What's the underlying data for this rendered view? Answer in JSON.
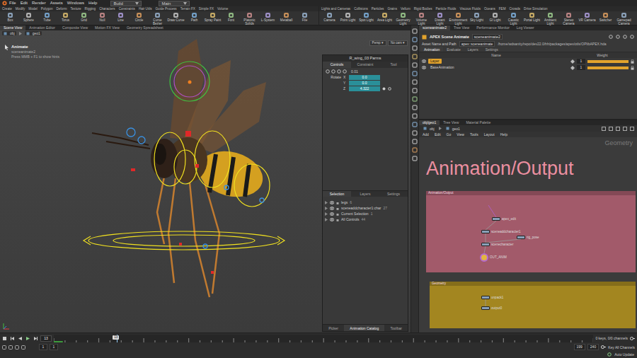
{
  "menubar": {
    "items": [
      "File",
      "Edit",
      "Render",
      "Assets",
      "Windows",
      "Help"
    ],
    "desktop": "Build",
    "shelf_set": "Main"
  },
  "shelf_left": {
    "tabs": [
      "Create",
      "Modify",
      "Model",
      "Polygon",
      "Deform",
      "Texture",
      "Rigging",
      "Characters",
      "Constraints",
      "Hair Utils",
      "Guide Process",
      "Terrain FX",
      "Simple FX",
      "Volume"
    ],
    "tools": [
      "Box",
      "Sphere",
      "Tube",
      "Torus",
      "Grid",
      "Null",
      "Line",
      "Circle",
      "Curve Bezier",
      "Draw Curve",
      "Path",
      "Spray Paint",
      "Font",
      "Platonic Solids",
      "L-System",
      "Metaball",
      "File"
    ]
  },
  "shelf_right": {
    "tabs": [
      "Lights and Cameras",
      "Collisions",
      "Particles",
      "Grains",
      "Vellum",
      "Rigid Bodies",
      "Particle Fluids",
      "Viscous Fluids",
      "Oceans",
      "FEM",
      "Crowds",
      "Drive Simulation"
    ],
    "tools": [
      "Camera",
      "Point Light",
      "Spot Light",
      "Area Light",
      "Geometry Light",
      "Volume Light",
      "Distant Light",
      "Environment Light",
      "Sky Light",
      "GI Light",
      "Caustic Light",
      "Portal Light",
      "Ambient Light",
      "Stereo Camera",
      "VR Camera",
      "Switcher",
      "Gamepad Camera"
    ]
  },
  "pane_tabs": [
    {
      "label": "Scene View",
      "selected": true
    },
    {
      "label": "Animation Editor",
      "selected": false
    },
    {
      "label": "Composite View",
      "selected": false
    },
    {
      "label": "Motion FX View",
      "selected": false
    },
    {
      "label": "Geometry Spreadsheet",
      "selected": false
    }
  ],
  "viewport": {
    "path": [
      "obj",
      "geo1"
    ],
    "tool": "Animate",
    "node": "sceneanimate2",
    "hint": "Press MMB + F1 to show hints",
    "view": "Persp ▾",
    "camera": "No cam ▾"
  },
  "parms": {
    "title": "R_wing_03 Parms",
    "tabs": [
      {
        "label": "Controls",
        "selected": true
      },
      {
        "label": "Constraint",
        "selected": false
      },
      {
        "label": "Tool",
        "selected": false
      }
    ],
    "step": "0.01",
    "label": "Rotate",
    "rows": [
      {
        "axis": "X",
        "value": "0.0"
      },
      {
        "axis": "Y",
        "value": "0.0"
      },
      {
        "axis": "Z",
        "value": "4.322"
      }
    ]
  },
  "outliner": {
    "tabs": [
      {
        "label": "Selection",
        "selected": true
      },
      {
        "label": "Layers",
        "selected": false
      },
      {
        "label": "Settings",
        "selected": false
      }
    ],
    "items": [
      {
        "name": "legs",
        "count": "6"
      },
      {
        "name": "sceneaddcharacter1:char",
        "count": "27"
      },
      {
        "name": "Current Selection",
        "count": "1"
      },
      {
        "name": "All Controls",
        "count": "44"
      }
    ],
    "bottom_tabs": [
      {
        "label": "Picker",
        "selected": false
      },
      {
        "label": "Animation Catalog",
        "selected": true
      },
      {
        "label": "Toolbar",
        "selected": false
      }
    ]
  },
  "apex": {
    "tabs": [
      {
        "label": "sceneanimate2",
        "selected": true
      },
      {
        "label": "Tree View",
        "selected": false
      },
      {
        "label": "Performance Monitor",
        "selected": false
      },
      {
        "label": "Log Viewer",
        "selected": false
      }
    ],
    "node_type": "APEX Scene Animate",
    "node_name": "sceneanimate2",
    "asset_label": "Asset Name and Path",
    "asset_name": "apex::sceneanimate",
    "asset_path": "/home/wdsanity/repo/dev22.0/hh/packages/apex/otls/OPlibAPEX.hda",
    "subtabs": [
      {
        "label": "Animation",
        "selected": true
      },
      {
        "label": "Evaluate",
        "selected": false
      },
      {
        "label": "Layers",
        "selected": false
      },
      {
        "label": "Settings",
        "selected": false
      }
    ],
    "columns": [
      "Name",
      "Weight"
    ],
    "layers": [
      {
        "name": "Layer",
        "selected": true,
        "weight": "1",
        "level": 1
      },
      {
        "name": "BaseAnimation",
        "selected": false,
        "weight": "1",
        "level": 1
      }
    ]
  },
  "network": {
    "tabs": [
      {
        "label": "obj/geo1",
        "selected": true
      },
      {
        "label": "Tree View",
        "selected": false
      },
      {
        "label": "Material Palette",
        "selected": false
      }
    ],
    "path": [
      "obj",
      "geo1"
    ],
    "menu": [
      "Add",
      "Edit",
      "Go",
      "View",
      "Tools",
      "Layout",
      "Help"
    ],
    "context": "Geometry",
    "sticky": "Animation/Output",
    "boxes": [
      {
        "title": "Animation/Output",
        "color": "#a25a6a"
      },
      {
        "title": "Geometry",
        "color": "#a38620"
      }
    ],
    "nodes": [
      {
        "name": "apex_edit",
        "selected": false
      },
      {
        "name": "sceneaddcharacter1",
        "selected": false
      },
      {
        "name": "rig_pose",
        "selected": false
      },
      {
        "name": "scenecharacter",
        "selected": false
      },
      {
        "name": "OUT_ANIM",
        "selected": true
      },
      {
        "name": "unpack1",
        "selected": false
      },
      {
        "name": "output0",
        "selected": false
      }
    ]
  },
  "timeline": {
    "frame": "13",
    "playhead": 0.117,
    "start": "1",
    "start2": "1",
    "end": "199",
    "end2": "240",
    "keys": "0 keys, 0/0 channels",
    "key_all": "Key All Channels",
    "auto_update": "Auto Update"
  }
}
